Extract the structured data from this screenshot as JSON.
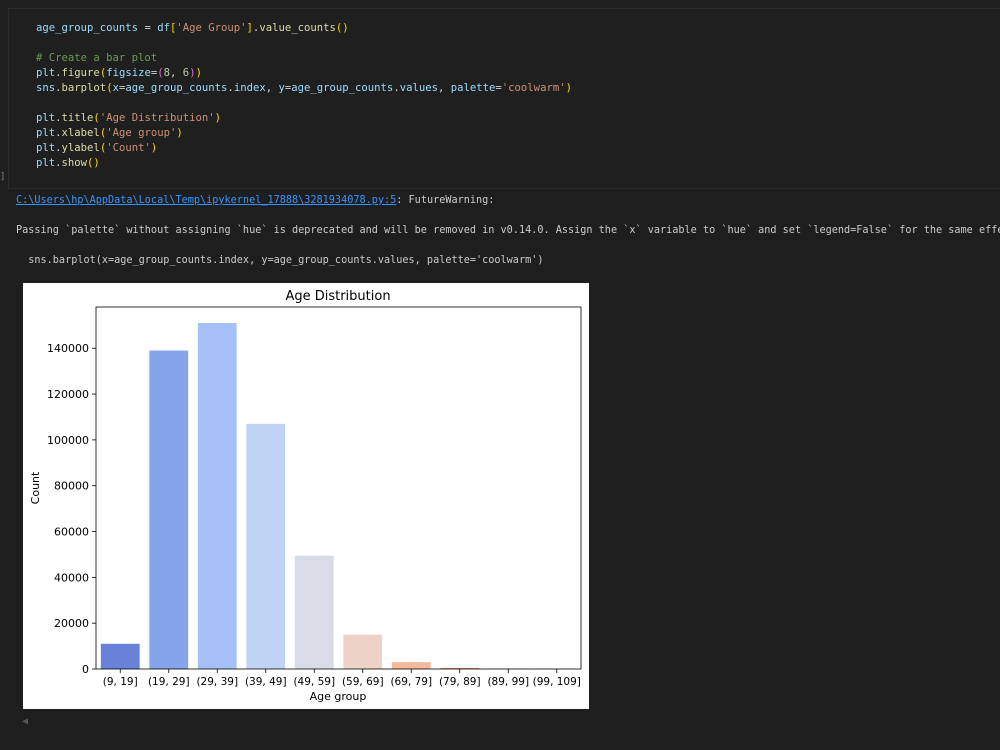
{
  "execution_count": "]",
  "code_lines": [
    [
      {
        "t": "age_group_counts",
        "c": "k-var"
      },
      {
        "t": " = "
      },
      {
        "t": "df",
        "c": "k-var"
      },
      {
        "t": "[",
        "c": "k-br"
      },
      {
        "t": "'Age Group'",
        "c": "k-str"
      },
      {
        "t": "]",
        "c": "k-br"
      },
      {
        "t": "."
      },
      {
        "t": "value_counts",
        "c": "k-fn"
      },
      {
        "t": "()",
        "c": "k-br"
      }
    ],
    [],
    [
      {
        "t": "# Create a bar plot",
        "c": "k-com"
      }
    ],
    [
      {
        "t": "plt",
        "c": "k-var"
      },
      {
        "t": "."
      },
      {
        "t": "figure",
        "c": "k-fn"
      },
      {
        "t": "(",
        "c": "k-br"
      },
      {
        "t": "figsize",
        "c": "k-var"
      },
      {
        "t": "="
      },
      {
        "t": "(",
        "c": "k-br2"
      },
      {
        "t": "8",
        "c": "k-num"
      },
      {
        "t": ", "
      },
      {
        "t": "6",
        "c": "k-num"
      },
      {
        "t": ")",
        "c": "k-br2"
      },
      {
        "t": ")",
        "c": "k-br"
      }
    ],
    [
      {
        "t": "sns",
        "c": "k-var"
      },
      {
        "t": "."
      },
      {
        "t": "barplot",
        "c": "k-fn"
      },
      {
        "t": "(",
        "c": "k-br"
      },
      {
        "t": "x",
        "c": "k-var"
      },
      {
        "t": "="
      },
      {
        "t": "age_group_counts",
        "c": "k-var"
      },
      {
        "t": "."
      },
      {
        "t": "index",
        "c": "k-var"
      },
      {
        "t": ", "
      },
      {
        "t": "y",
        "c": "k-var"
      },
      {
        "t": "="
      },
      {
        "t": "age_group_counts",
        "c": "k-var"
      },
      {
        "t": "."
      },
      {
        "t": "values",
        "c": "k-var"
      },
      {
        "t": ", "
      },
      {
        "t": "palette",
        "c": "k-var"
      },
      {
        "t": "="
      },
      {
        "t": "'coolwarm'",
        "c": "k-str"
      },
      {
        "t": ")",
        "c": "k-br"
      }
    ],
    [],
    [
      {
        "t": "plt",
        "c": "k-var"
      },
      {
        "t": "."
      },
      {
        "t": "title",
        "c": "k-fn"
      },
      {
        "t": "(",
        "c": "k-br"
      },
      {
        "t": "'Age Distribution'",
        "c": "k-str"
      },
      {
        "t": ")",
        "c": "k-br"
      }
    ],
    [
      {
        "t": "plt",
        "c": "k-var"
      },
      {
        "t": "."
      },
      {
        "t": "xlabel",
        "c": "k-fn"
      },
      {
        "t": "(",
        "c": "k-br"
      },
      {
        "t": "'Age group'",
        "c": "k-str"
      },
      {
        "t": ")",
        "c": "k-br"
      }
    ],
    [
      {
        "t": "plt",
        "c": "k-var"
      },
      {
        "t": "."
      },
      {
        "t": "ylabel",
        "c": "k-fn"
      },
      {
        "t": "(",
        "c": "k-br"
      },
      {
        "t": "'Count'",
        "c": "k-str"
      },
      {
        "t": ")",
        "c": "k-br"
      }
    ],
    [
      {
        "t": "plt",
        "c": "k-var"
      },
      {
        "t": "."
      },
      {
        "t": "show",
        "c": "k-fn"
      },
      {
        "t": "()",
        "c": "k-br"
      }
    ]
  ],
  "output": {
    "warning_path": "C:\\Users\\hp\\AppData\\Local\\Temp\\ipykernel_17888\\3281934078.py:5",
    "warning_type": ": FutureWarning:",
    "warning_message": "Passing `palette` without assigning `hue` is deprecated and will be removed in v0.14.0. Assign the `x` variable to `hue` and set `legend=False` for the same effect",
    "warning_source": "  sns.barplot(x=age_group_counts.index, y=age_group_counts.values, palette='coolwarm')"
  },
  "scroll_arrow": "◀",
  "chart_data": {
    "type": "bar",
    "title": "Age Distribution",
    "xlabel": "Age group",
    "ylabel": "Count",
    "categories": [
      "(9, 19]",
      "(19, 29]",
      "(29, 39]",
      "(39, 49]",
      "(49, 59]",
      "(59, 69]",
      "(69, 79]",
      "(79, 89]",
      "(89, 99]",
      "(99, 109]"
    ],
    "values": [
      11000,
      139000,
      151000,
      107000,
      49500,
      15000,
      3000,
      500,
      100,
      30
    ],
    "colors": [
      "#6a81da",
      "#86a4ea",
      "#a5c0f6",
      "#c0d3f5",
      "#d7dce6",
      "#ecd2c7",
      "#f3b99b",
      "#ed9572",
      "#de6b50",
      "#c83e38"
    ],
    "yticks": [
      0,
      20000,
      40000,
      60000,
      80000,
      100000,
      120000,
      140000
    ],
    "ylim": [
      0,
      158000
    ],
    "grid": false
  }
}
